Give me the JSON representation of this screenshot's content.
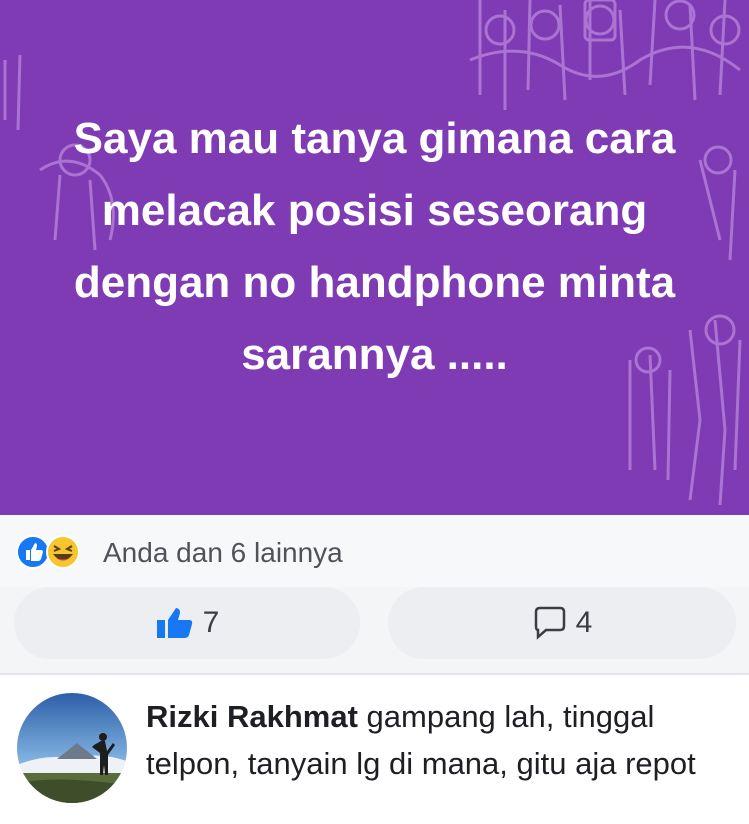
{
  "post": {
    "text_lines": [
      "Saya mau tanya gimana cara",
      "melacak posisi seseorang",
      "dengan no handphone minta",
      "sarannya ....."
    ],
    "background_color": "#7e3bb3"
  },
  "reactions": {
    "icons": [
      "like-reaction-icon",
      "haha-reaction-icon"
    ],
    "summary": "Anda dan 6 lainnya"
  },
  "actions": {
    "like_count": "7",
    "comment_count": "4"
  },
  "comment": {
    "author": "Rizki Rakhmat",
    "text": "gampang lah, tinggal telpon, tanyain lg di mana, gitu aja repot"
  },
  "colors": {
    "accent_blue": "#1877f2",
    "haha_yellow": "#f7c62f"
  }
}
